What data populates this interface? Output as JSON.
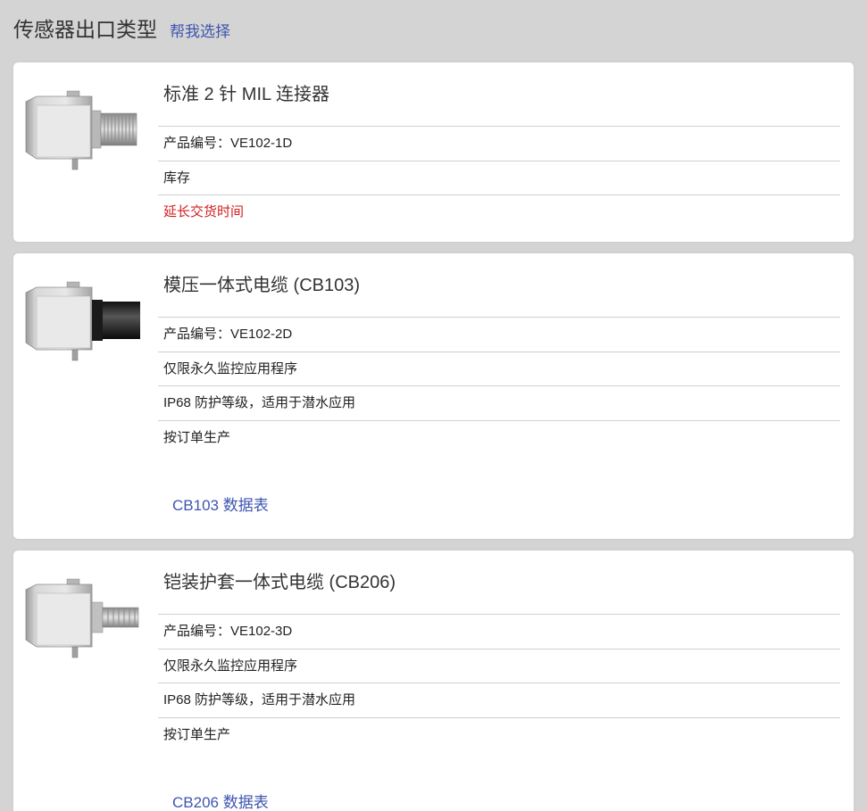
{
  "header": {
    "title": "传感器出口类型",
    "help_link": "帮我选择"
  },
  "cards": [
    {
      "title": "标准 2 针 MIL 连接器",
      "rows": [
        "产品编号：VE102-1D",
        "库存",
        "延长交货时间"
      ],
      "datasheet": ""
    },
    {
      "title": "模压一体式电缆 (CB103)",
      "rows": [
        "产品编号：VE102-2D",
        "仅限永久监控应用程序",
        "IP68 防护等级，适用于潜水应用",
        "按订单生产"
      ],
      "datasheet": "CB103 数据表"
    },
    {
      "title": "铠装护套一体式电缆 (CB206)",
      "rows": [
        "产品编号：VE102-3D",
        "仅限永久监控应用程序",
        "IP68 防护等级，适用于潜水应用",
        "按订单生产"
      ],
      "datasheet": "CB206 数据表"
    }
  ],
  "colors": {
    "link": "#3e55b0",
    "warning": "#d21d1d",
    "background": "#d4d4d4"
  }
}
